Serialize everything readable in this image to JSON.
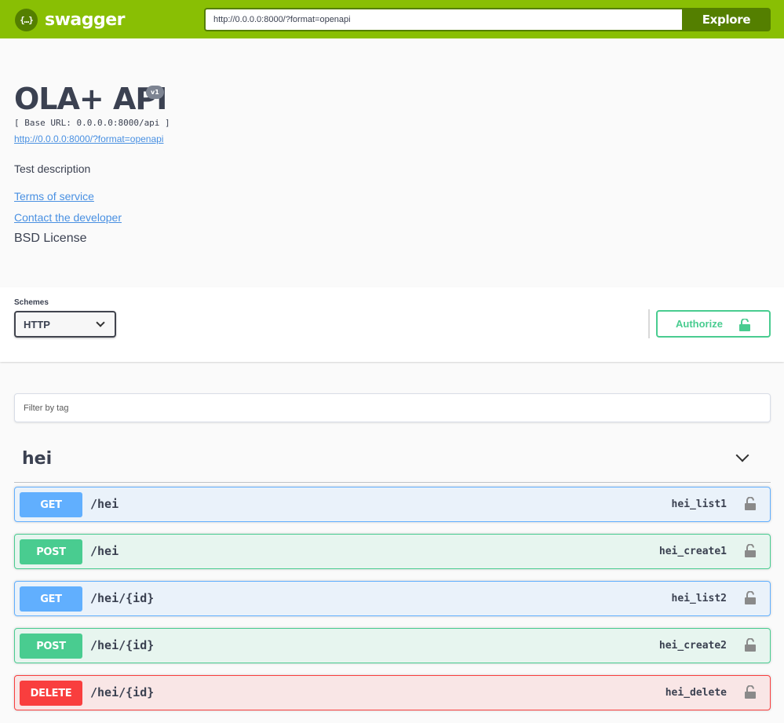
{
  "topbar": {
    "logo_icon": "{…}",
    "logo_text": "swagger",
    "url_value": "http://0.0.0.0:8000/?format=openapi",
    "explore_label": "Explore"
  },
  "info": {
    "title": "OLA+ API",
    "version": "v1",
    "base_url": "[ Base URL: 0.0.0.0:8000/api ]",
    "spec_link": "http://0.0.0.0:8000/?format=openapi",
    "description": "Test description",
    "terms_label": "Terms of service",
    "contact_label": "Contact the developer",
    "license": "BSD License"
  },
  "schemes": {
    "label": "Schemes",
    "selected": "HTTP",
    "authorize_label": "Authorize"
  },
  "filter": {
    "placeholder": "Filter by tag"
  },
  "tag": {
    "name": "hei"
  },
  "operations": [
    {
      "method": "GET",
      "path": "/hei",
      "operation_id": "hei_list1"
    },
    {
      "method": "POST",
      "path": "/hei",
      "operation_id": "hei_create1"
    },
    {
      "method": "GET",
      "path": "/hei/{id}",
      "operation_id": "hei_list2"
    },
    {
      "method": "POST",
      "path": "/hei/{id}",
      "operation_id": "hei_create2"
    },
    {
      "method": "DELETE",
      "path": "/hei/{id}",
      "operation_id": "hei_delete"
    }
  ],
  "colors": {
    "topbar": "#89bf04",
    "topbar_dark": "#547f00",
    "get": "#61affe",
    "post": "#49cc90",
    "delete": "#f93e3e",
    "link": "#4990e2"
  },
  "icons": {
    "logo": "swagger-logo-icon",
    "select_chevron": "chevron-down-icon",
    "authorize": "unlock-icon",
    "operation_lock": "unlock-icon",
    "tag_toggle": "chevron-down-icon"
  }
}
